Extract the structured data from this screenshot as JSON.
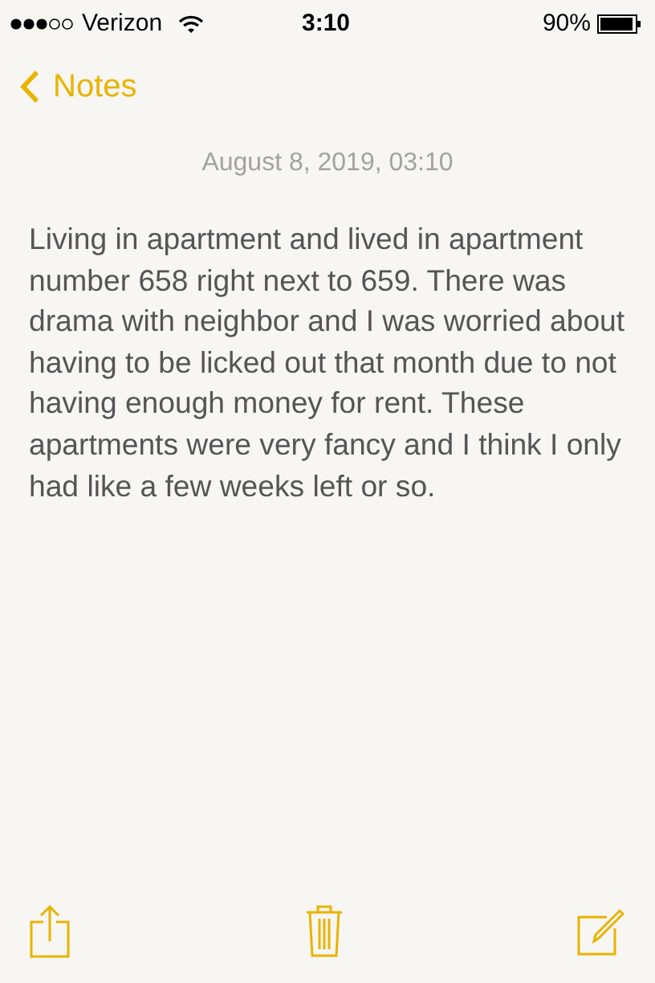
{
  "status_bar": {
    "carrier": "Verizon",
    "time": "3:10",
    "battery": "90%"
  },
  "nav": {
    "back": "Notes"
  },
  "note": {
    "date": "August 8, 2019, 03:10",
    "body": "Living in apartment and lived in apartment number 658 right next to 659. There was drama with neighbor and I was worried about having to be licked out that month due to not having enough money for rent. These apartments were very fancy and I think I only had like a few weeks left or so."
  }
}
